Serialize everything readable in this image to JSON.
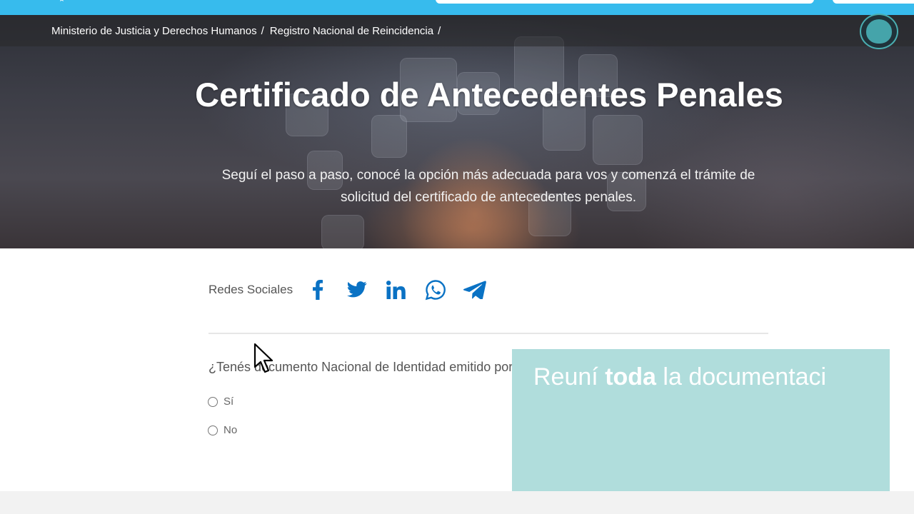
{
  "header": {
    "breadcrumb": [
      {
        "label": "Ministerio de Justicia y Derechos Humanos",
        "sep": "/"
      },
      {
        "label": "Registro Nacional de Reincidencia",
        "sep": "/"
      }
    ]
  },
  "hero": {
    "title": "Certificado de Antecedentes Penales",
    "subtitle": "Seguí el paso a paso, conocé la opción más adecuada para vos y comenzá el trámite de solicitud del certificado de antecedentes penales."
  },
  "social": {
    "label": "Redes Sociales",
    "icons": [
      "facebook-icon",
      "twitter-icon",
      "linkedin-icon",
      "whatsapp-icon",
      "telegram-icon"
    ],
    "color": "#0a72c4"
  },
  "form": {
    "question": "¿Tenés documento Nacional de Identidad emitido por la República Argentina?",
    "options": [
      {
        "label": "Sí",
        "selected": false
      },
      {
        "label": "No",
        "selected": false
      }
    ]
  },
  "overlay": {
    "text_prefix": "Reuní ",
    "text_bold": "toda",
    "text_suffix": " la documentaci"
  },
  "colors": {
    "topbar": "#37bbed",
    "overlay": "#b0dddc",
    "avatar_ring": "#4aaeb1"
  }
}
